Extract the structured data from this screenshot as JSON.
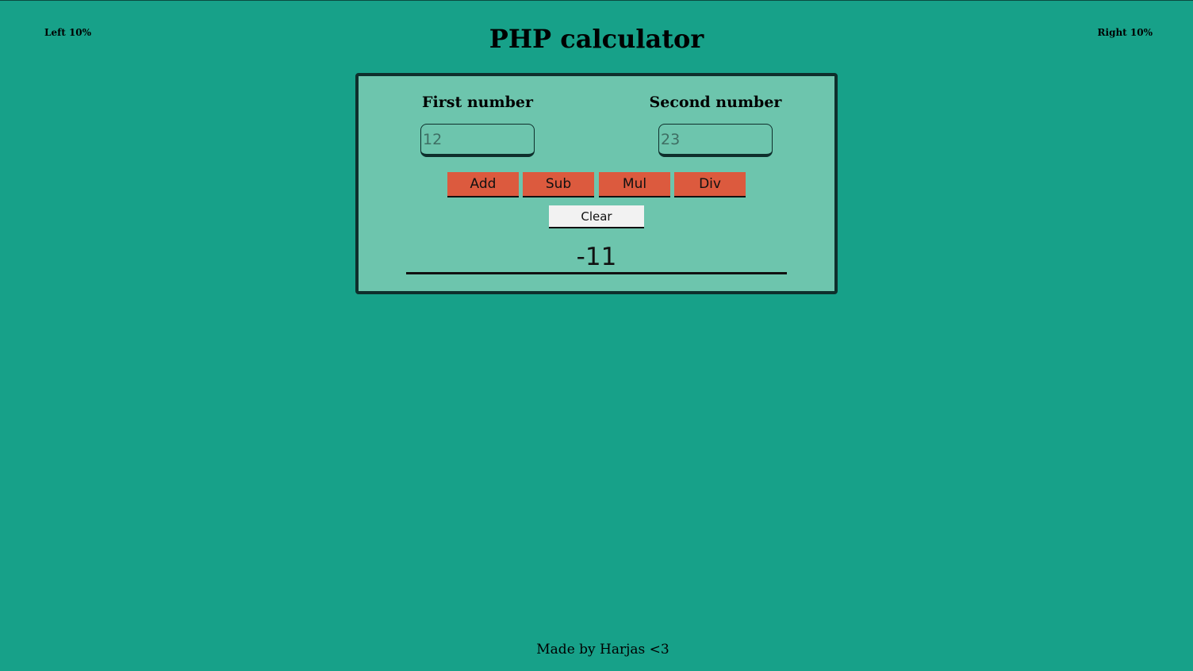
{
  "header": {
    "left_label": "Left 10%",
    "right_label": "Right 10%",
    "title": "PHP calculator"
  },
  "calculator": {
    "first_label": "First number",
    "second_label": "Second number",
    "first_placeholder": "12",
    "second_placeholder": "23",
    "buttons": {
      "add": "Add",
      "sub": "Sub",
      "mul": "Mul",
      "div": "Div",
      "clear": "Clear"
    },
    "result": "-11"
  },
  "footer": {
    "text": "Made by Harjas <3"
  },
  "colors": {
    "background": "#17a189",
    "panel": "#6dc5ad",
    "panel_border": "#0e2f2c",
    "operation_button": "#dc5a3e",
    "clear_button": "#f2f2f2"
  }
}
